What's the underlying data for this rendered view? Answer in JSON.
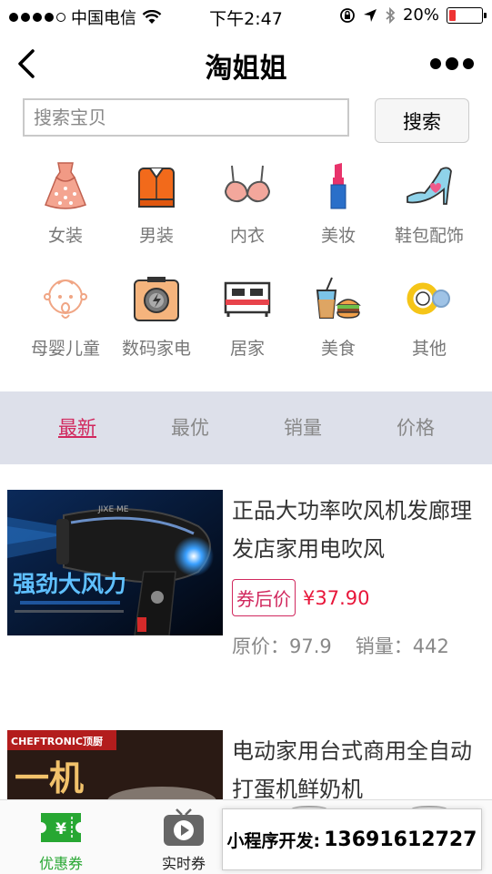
{
  "status_bar": {
    "carrier": "中国电信",
    "time": "下午2:47",
    "battery_percent": "20%",
    "battery_level": 0.2,
    "signal_bars": 4
  },
  "nav": {
    "title": "淘姐姐"
  },
  "search": {
    "placeholder": "搜索宝贝",
    "button_label": "搜索"
  },
  "categories": [
    {
      "label": "女装",
      "icon": "dress-icon"
    },
    {
      "label": "男装",
      "icon": "shirt-icon"
    },
    {
      "label": "内衣",
      "icon": "bra-icon"
    },
    {
      "label": "美妆",
      "icon": "lipstick-icon"
    },
    {
      "label": "鞋包配饰",
      "icon": "high-heel-icon"
    },
    {
      "label": "母婴儿童",
      "icon": "baby-icon"
    },
    {
      "label": "数码家电",
      "icon": "camera-icon"
    },
    {
      "label": "居家",
      "icon": "bed-icon"
    },
    {
      "label": "美食",
      "icon": "food-icon"
    },
    {
      "label": "其他",
      "icon": "rings-icon"
    }
  ],
  "sort_tabs": [
    {
      "label": "最新",
      "active": true
    },
    {
      "label": "最优",
      "active": false
    },
    {
      "label": "销量",
      "active": false
    },
    {
      "label": "价格",
      "active": false
    }
  ],
  "products": [
    {
      "title": "正品大功率吹风机发廊理发店家用电吹风",
      "coupon_label": "券后价",
      "coupon_price": "¥37.90",
      "original_price_label": "原价：",
      "original_price": "97.9",
      "sales_label": "销量：",
      "sales": "442",
      "image_caption": "强劲大风力",
      "image_brand": "JIXE ME"
    },
    {
      "title": "电动家用台式商用全自动打蛋机鲜奶机",
      "image_brand": "CHEFTRONIC顶厨",
      "image_caption": "一机"
    }
  ],
  "tab_bar": [
    {
      "label": "优惠券",
      "icon": "coupon-icon",
      "active": true
    },
    {
      "label": "实时券",
      "icon": "play-icon",
      "active": false
    }
  ],
  "promo": {
    "label": "小程序开发:",
    "phone": "13691612727"
  },
  "colors": {
    "accent": "#d1285e",
    "price": "#e8163a",
    "tab_active": "#27a732",
    "sort_bg": "#dde0ea"
  }
}
